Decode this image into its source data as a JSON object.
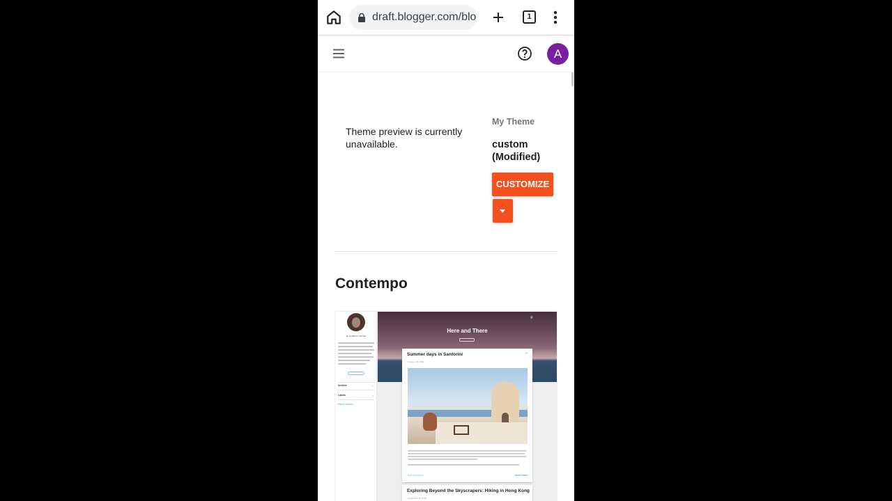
{
  "browser": {
    "url": "draft.blogger.com/blo",
    "tab_count": "1"
  },
  "app_header": {
    "avatar_initial": "A"
  },
  "current_theme": {
    "preview_message": "Theme preview is currently unavailable.",
    "my_theme_label": "My Theme",
    "theme_name": "custom (Modified)",
    "customize_label": "CUSTOMIZE"
  },
  "gallery": {
    "section_title": "Contempo",
    "thumbnail": {
      "blog_title": "Here and There",
      "author": "ELIZABETH ROSE",
      "sidebar_items": [
        "Archive",
        "Labels"
      ],
      "report_link": "Report Abuse",
      "posts": [
        {
          "title": "Summer days in Santorini",
          "date": "October 18, 2016"
        },
        {
          "title": "Exploring Beyond the Skyscrapers: Hiking in Hong Kong",
          "date": "September 12, 2016"
        }
      ],
      "comment_link": "Post a Comment",
      "read_more": "READ MORE"
    }
  },
  "colors": {
    "accent": "#f4511e",
    "avatar_bg": "#7b1fa2",
    "link": "#29b6f6"
  },
  "icons": [
    "home-icon",
    "lock-icon",
    "plus-icon",
    "tab-switcher-icon",
    "more-vert-icon",
    "hamburger-icon",
    "help-icon",
    "caret-down-icon",
    "share-icon",
    "search-icon"
  ]
}
